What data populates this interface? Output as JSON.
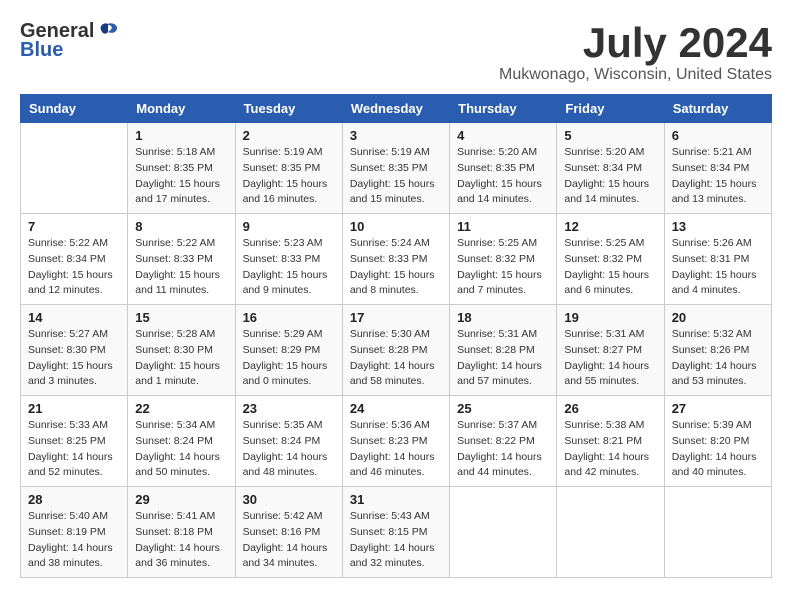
{
  "header": {
    "logo_general": "General",
    "logo_blue": "Blue",
    "month_title": "July 2024",
    "location": "Mukwonago, Wisconsin, United States"
  },
  "calendar": {
    "days_of_week": [
      "Sunday",
      "Monday",
      "Tuesday",
      "Wednesday",
      "Thursday",
      "Friday",
      "Saturday"
    ],
    "weeks": [
      [
        {
          "day": "",
          "info": ""
        },
        {
          "day": "1",
          "info": "Sunrise: 5:18 AM\nSunset: 8:35 PM\nDaylight: 15 hours\nand 17 minutes."
        },
        {
          "day": "2",
          "info": "Sunrise: 5:19 AM\nSunset: 8:35 PM\nDaylight: 15 hours\nand 16 minutes."
        },
        {
          "day": "3",
          "info": "Sunrise: 5:19 AM\nSunset: 8:35 PM\nDaylight: 15 hours\nand 15 minutes."
        },
        {
          "day": "4",
          "info": "Sunrise: 5:20 AM\nSunset: 8:35 PM\nDaylight: 15 hours\nand 14 minutes."
        },
        {
          "day": "5",
          "info": "Sunrise: 5:20 AM\nSunset: 8:34 PM\nDaylight: 15 hours\nand 14 minutes."
        },
        {
          "day": "6",
          "info": "Sunrise: 5:21 AM\nSunset: 8:34 PM\nDaylight: 15 hours\nand 13 minutes."
        }
      ],
      [
        {
          "day": "7",
          "info": "Sunrise: 5:22 AM\nSunset: 8:34 PM\nDaylight: 15 hours\nand 12 minutes."
        },
        {
          "day": "8",
          "info": "Sunrise: 5:22 AM\nSunset: 8:33 PM\nDaylight: 15 hours\nand 11 minutes."
        },
        {
          "day": "9",
          "info": "Sunrise: 5:23 AM\nSunset: 8:33 PM\nDaylight: 15 hours\nand 9 minutes."
        },
        {
          "day": "10",
          "info": "Sunrise: 5:24 AM\nSunset: 8:33 PM\nDaylight: 15 hours\nand 8 minutes."
        },
        {
          "day": "11",
          "info": "Sunrise: 5:25 AM\nSunset: 8:32 PM\nDaylight: 15 hours\nand 7 minutes."
        },
        {
          "day": "12",
          "info": "Sunrise: 5:25 AM\nSunset: 8:32 PM\nDaylight: 15 hours\nand 6 minutes."
        },
        {
          "day": "13",
          "info": "Sunrise: 5:26 AM\nSunset: 8:31 PM\nDaylight: 15 hours\nand 4 minutes."
        }
      ],
      [
        {
          "day": "14",
          "info": "Sunrise: 5:27 AM\nSunset: 8:30 PM\nDaylight: 15 hours\nand 3 minutes."
        },
        {
          "day": "15",
          "info": "Sunrise: 5:28 AM\nSunset: 8:30 PM\nDaylight: 15 hours\nand 1 minute."
        },
        {
          "day": "16",
          "info": "Sunrise: 5:29 AM\nSunset: 8:29 PM\nDaylight: 15 hours\nand 0 minutes."
        },
        {
          "day": "17",
          "info": "Sunrise: 5:30 AM\nSunset: 8:28 PM\nDaylight: 14 hours\nand 58 minutes."
        },
        {
          "day": "18",
          "info": "Sunrise: 5:31 AM\nSunset: 8:28 PM\nDaylight: 14 hours\nand 57 minutes."
        },
        {
          "day": "19",
          "info": "Sunrise: 5:31 AM\nSunset: 8:27 PM\nDaylight: 14 hours\nand 55 minutes."
        },
        {
          "day": "20",
          "info": "Sunrise: 5:32 AM\nSunset: 8:26 PM\nDaylight: 14 hours\nand 53 minutes."
        }
      ],
      [
        {
          "day": "21",
          "info": "Sunrise: 5:33 AM\nSunset: 8:25 PM\nDaylight: 14 hours\nand 52 minutes."
        },
        {
          "day": "22",
          "info": "Sunrise: 5:34 AM\nSunset: 8:24 PM\nDaylight: 14 hours\nand 50 minutes."
        },
        {
          "day": "23",
          "info": "Sunrise: 5:35 AM\nSunset: 8:24 PM\nDaylight: 14 hours\nand 48 minutes."
        },
        {
          "day": "24",
          "info": "Sunrise: 5:36 AM\nSunset: 8:23 PM\nDaylight: 14 hours\nand 46 minutes."
        },
        {
          "day": "25",
          "info": "Sunrise: 5:37 AM\nSunset: 8:22 PM\nDaylight: 14 hours\nand 44 minutes."
        },
        {
          "day": "26",
          "info": "Sunrise: 5:38 AM\nSunset: 8:21 PM\nDaylight: 14 hours\nand 42 minutes."
        },
        {
          "day": "27",
          "info": "Sunrise: 5:39 AM\nSunset: 8:20 PM\nDaylight: 14 hours\nand 40 minutes."
        }
      ],
      [
        {
          "day": "28",
          "info": "Sunrise: 5:40 AM\nSunset: 8:19 PM\nDaylight: 14 hours\nand 38 minutes."
        },
        {
          "day": "29",
          "info": "Sunrise: 5:41 AM\nSunset: 8:18 PM\nDaylight: 14 hours\nand 36 minutes."
        },
        {
          "day": "30",
          "info": "Sunrise: 5:42 AM\nSunset: 8:16 PM\nDaylight: 14 hours\nand 34 minutes."
        },
        {
          "day": "31",
          "info": "Sunrise: 5:43 AM\nSunset: 8:15 PM\nDaylight: 14 hours\nand 32 minutes."
        },
        {
          "day": "",
          "info": ""
        },
        {
          "day": "",
          "info": ""
        },
        {
          "day": "",
          "info": ""
        }
      ]
    ]
  }
}
